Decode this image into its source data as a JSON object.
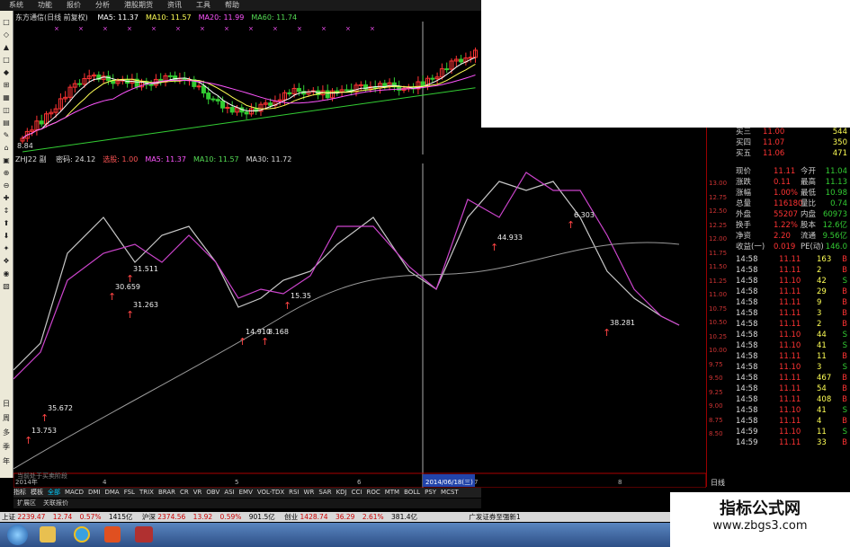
{
  "menu": [
    "系统",
    "功能",
    "报价",
    "分析",
    "港股期货",
    "资讯",
    "工具",
    "帮助"
  ],
  "main_chart": {
    "title": "东方通信(日线 前复权)",
    "ma": [
      {
        "label": "MA5: 11.37",
        "color": "#ffffff"
      },
      {
        "label": "MA10: 11.57",
        "color": "#ffff55"
      },
      {
        "label": "MA20: 11.99",
        "color": "#ff55ff"
      },
      {
        "label": "MA60: 11.74",
        "color": "#55dd55"
      }
    ],
    "low_label": "8.84",
    "price_ticks": [
      "9.00"
    ]
  },
  "indicator": {
    "name": "ZHJ22 副",
    "params": [
      "密码: 24.12",
      "选股: 1.00",
      "MA5: 11.37",
      "MA10: 11.57",
      "MA30: 11.72"
    ],
    "marks": [
      "13.753",
      "35.672",
      "30.659",
      "31.511",
      "31.263",
      "14.910",
      "8.168",
      "15.35",
      "44.933",
      "6.303",
      "38.281"
    ],
    "footer_note": "当前处于买卖阶段"
  },
  "price_axis": [
    "13.00",
    "12.75",
    "12.50",
    "12.25",
    "12.00",
    "11.75",
    "11.50",
    "11.25",
    "11.00",
    "10.75",
    "10.50",
    "10.25",
    "10.00",
    "9.75",
    "9.50",
    "9.25",
    "9.00",
    "8.75",
    "8.50"
  ],
  "date_axis": {
    "start": "2014年",
    "months": [
      "4",
      "5",
      "6",
      "7",
      "8"
    ],
    "cursor_date": "2014/06/18(三)"
  },
  "quote": {
    "asks": [
      {
        "label": "买三",
        "price": "11.00",
        "vol": "544"
      },
      {
        "label": "买四",
        "price": "11.07",
        "vol": "350"
      },
      {
        "label": "买五",
        "price": "11.06",
        "vol": "471"
      }
    ],
    "stats": [
      {
        "l1": "现价",
        "v1": "11.11",
        "l2": "今开",
        "v2": "11.04"
      },
      {
        "l1": "涨跌",
        "v1": "0.11",
        "l2": "最高",
        "v2": "11.13"
      },
      {
        "l1": "涨幅",
        "v1": "1.00%",
        "l2": "最低",
        "v2": "10.98"
      },
      {
        "l1": "总量",
        "v1": "116180",
        "l2": "量比",
        "v2": "0.74"
      },
      {
        "l1": "外盘",
        "v1": "55207",
        "l2": "内盘",
        "v2": "60973"
      },
      {
        "l1": "换手",
        "v1": "1.22%",
        "l2": "股本",
        "v2": "12.6亿"
      },
      {
        "l1": "净资",
        "v1": "2.20",
        "l2": "流通",
        "v2": "9.56亿"
      },
      {
        "l1": "收益(一)",
        "v1": "0.019",
        "l2": "PE(动)",
        "v2": "146.0"
      }
    ],
    "ticks": [
      {
        "t": "14:58",
        "p": "11.11",
        "v": "163",
        "s": "B"
      },
      {
        "t": "14:58",
        "p": "11.11",
        "v": "2",
        "s": "B"
      },
      {
        "t": "14:58",
        "p": "11.10",
        "v": "42",
        "s": "S"
      },
      {
        "t": "14:58",
        "p": "11.11",
        "v": "29",
        "s": "B"
      },
      {
        "t": "14:58",
        "p": "11.11",
        "v": "9",
        "s": "B"
      },
      {
        "t": "14:58",
        "p": "11.11",
        "v": "3",
        "s": "B"
      },
      {
        "t": "14:58",
        "p": "11.11",
        "v": "2",
        "s": "B"
      },
      {
        "t": "14:58",
        "p": "11.10",
        "v": "44",
        "s": "S"
      },
      {
        "t": "14:58",
        "p": "11.10",
        "v": "41",
        "s": "S"
      },
      {
        "t": "14:58",
        "p": "11.11",
        "v": "11",
        "s": "B"
      },
      {
        "t": "14:58",
        "p": "11.10",
        "v": "3",
        "s": "S"
      },
      {
        "t": "14:58",
        "p": "11.11",
        "v": "467",
        "s": "B"
      },
      {
        "t": "14:58",
        "p": "11.11",
        "v": "54",
        "s": "B"
      },
      {
        "t": "14:58",
        "p": "11.11",
        "v": "408",
        "s": "B"
      },
      {
        "t": "14:58",
        "p": "11.10",
        "v": "41",
        "s": "S"
      },
      {
        "t": "14:58",
        "p": "11.11",
        "v": "4",
        "s": "B"
      },
      {
        "t": "14:59",
        "p": "11.10",
        "v": "11",
        "s": "S"
      },
      {
        "t": "14:59",
        "p": "11.11",
        "v": "33",
        "s": "B"
      }
    ],
    "period_label": "日线"
  },
  "tabs": [
    "指标",
    "模板",
    "全部",
    "MACD",
    "DMI",
    "DMA",
    "FSL",
    "TRIX",
    "BRAR",
    "CR",
    "VR",
    "OBV",
    "ASI",
    "EMV",
    "VOL-TDX",
    "RSI",
    "WR",
    "SAR",
    "KDJ",
    "CCI",
    "ROC",
    "MTM",
    "BOLL",
    "PSY",
    "MCST"
  ],
  "subtabs": [
    "扩展区",
    "关联报价"
  ],
  "status": {
    "sh_label": "上证",
    "sh_val": "2239.47",
    "sh_chg": "12.74",
    "sh_pct": "0.57%",
    "sh_amt": "1415亿",
    "sz_label": "沪深",
    "sz_val": "2374.56",
    "sz_chg": "13.92",
    "sz_pct": "0.59%",
    "sz_amt": "901.5亿",
    "cy_label": "创业",
    "cy_val": "1428.74",
    "cy_chg": "36.29",
    "cy_pct": "2.61%",
    "cy_amt": "381.4亿",
    "broker": "广发证券至强新1"
  },
  "watermark": {
    "title": "指标公式网",
    "url": "www.zbgs3.com"
  },
  "colors": {
    "up": "#ff3333",
    "down": "#33cc33",
    "axis_red": "#cc0000",
    "price_blue": "#ffff00"
  }
}
